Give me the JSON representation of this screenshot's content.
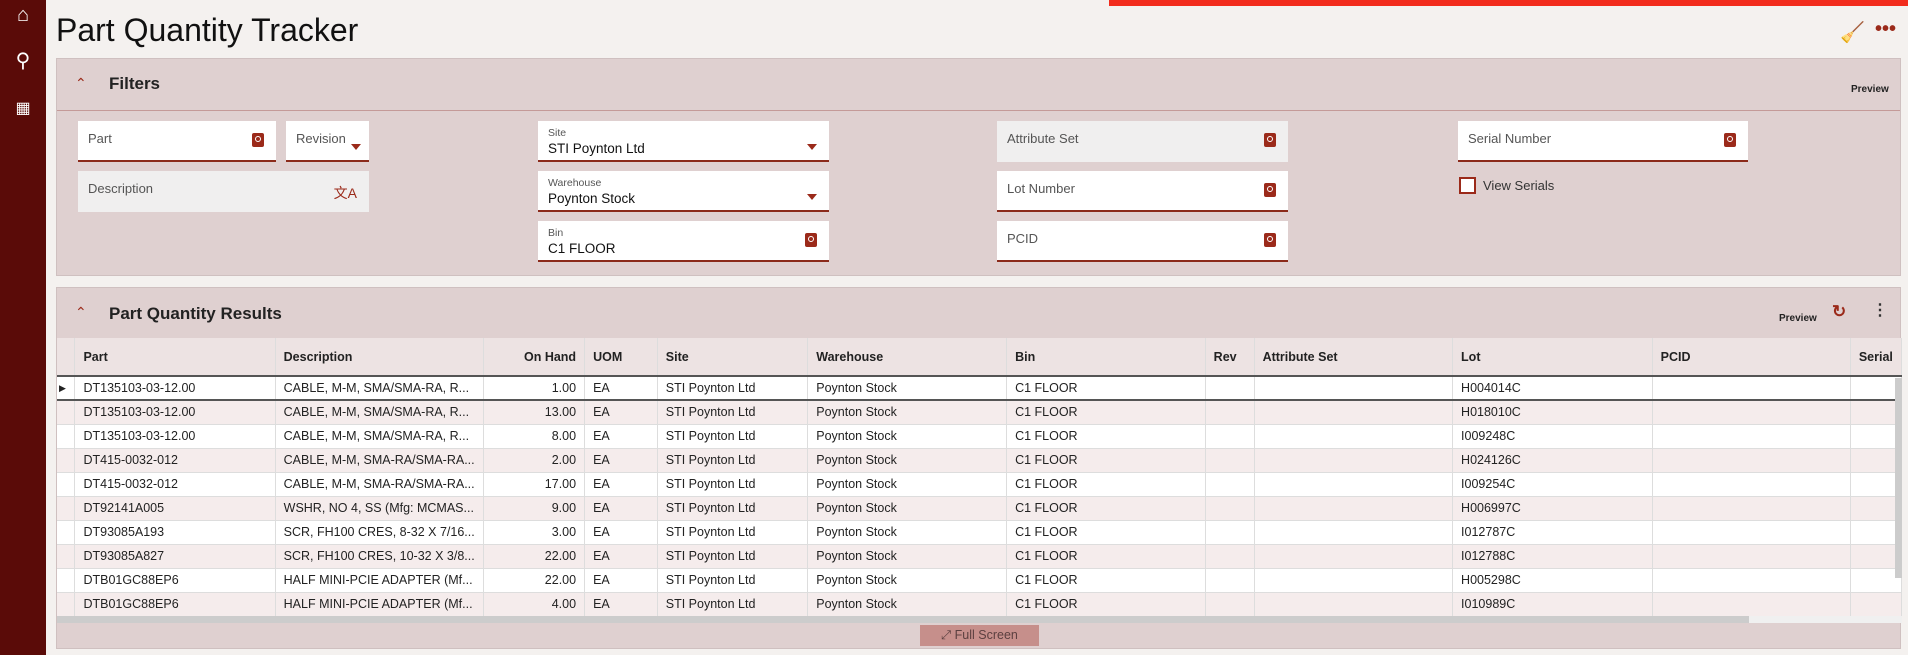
{
  "sidebar": {
    "items": [
      {
        "icon": "home-icon"
      },
      {
        "icon": "search-icon"
      },
      {
        "icon": "apps-grid-icon"
      }
    ]
  },
  "header": {
    "title": "Part Quantity Tracker"
  },
  "filters": {
    "title": "Filters",
    "preview": "Preview",
    "part": {
      "label": "Part",
      "value": ""
    },
    "revision": {
      "label": "Revision"
    },
    "description": {
      "label": "Description"
    },
    "site": {
      "label": "Site",
      "value": "STI Poynton Ltd"
    },
    "warehouse": {
      "label": "Warehouse",
      "value": "Poynton Stock"
    },
    "bin": {
      "label": "Bin",
      "value": "C1 FLOOR"
    },
    "attribute_set": {
      "label": "Attribute Set"
    },
    "lot_number": {
      "label": "Lot Number"
    },
    "pcid": {
      "label": "PCID"
    },
    "serial_number": {
      "label": "Serial Number"
    },
    "view_serials": {
      "label": "View Serials",
      "checked": false
    }
  },
  "results": {
    "title": "Part Quantity Results",
    "preview": "Preview",
    "full_screen": "Full Screen",
    "columns": [
      "Part",
      "Description",
      "On Hand",
      "UOM",
      "Site",
      "Warehouse",
      "Bin",
      "Rev",
      "Attribute Set",
      "Lot",
      "PCID",
      "Serial"
    ],
    "rows": [
      [
        "DT135103-03-12.00",
        "CABLE, M-M, SMA/SMA-RA, R...",
        "1.00",
        "EA",
        "STI Poynton Ltd",
        "Poynton Stock",
        "C1 FLOOR",
        "",
        "",
        "H004014C",
        "",
        ""
      ],
      [
        "DT135103-03-12.00",
        "CABLE, M-M, SMA/SMA-RA, R...",
        "13.00",
        "EA",
        "STI Poynton Ltd",
        "Poynton Stock",
        "C1 FLOOR",
        "",
        "",
        "H018010C",
        "",
        ""
      ],
      [
        "DT135103-03-12.00",
        "CABLE, M-M, SMA/SMA-RA, R...",
        "8.00",
        "EA",
        "STI Poynton Ltd",
        "Poynton Stock",
        "C1 FLOOR",
        "",
        "",
        "I009248C",
        "",
        ""
      ],
      [
        "DT415-0032-012",
        "CABLE, M-M, SMA-RA/SMA-RA...",
        "2.00",
        "EA",
        "STI Poynton Ltd",
        "Poynton Stock",
        "C1 FLOOR",
        "",
        "",
        "H024126C",
        "",
        ""
      ],
      [
        "DT415-0032-012",
        "CABLE, M-M, SMA-RA/SMA-RA...",
        "17.00",
        "EA",
        "STI Poynton Ltd",
        "Poynton Stock",
        "C1 FLOOR",
        "",
        "",
        "I009254C",
        "",
        ""
      ],
      [
        "DT92141A005",
        "WSHR, NO 4, SS (Mfg: MCMAS...",
        "9.00",
        "EA",
        "STI Poynton Ltd",
        "Poynton Stock",
        "C1 FLOOR",
        "",
        "",
        "H006997C",
        "",
        ""
      ],
      [
        "DT93085A193",
        "SCR, FH100 CRES, 8-32 X 7/16...",
        "3.00",
        "EA",
        "STI Poynton Ltd",
        "Poynton Stock",
        "C1 FLOOR",
        "",
        "",
        "I012787C",
        "",
        ""
      ],
      [
        "DT93085A827",
        "SCR, FH100 CRES, 10-32 X 3/8...",
        "22.00",
        "EA",
        "STI Poynton Ltd",
        "Poynton Stock",
        "C1 FLOOR",
        "",
        "",
        "I012788C",
        "",
        ""
      ],
      [
        "DTB01GC88EP6",
        "HALF MINI-PCIE ADAPTER (Mf...",
        "22.00",
        "EA",
        "STI Poynton Ltd",
        "Poynton Stock",
        "C1 FLOOR",
        "",
        "",
        "H005298C",
        "",
        ""
      ],
      [
        "DTB01GC88EP6",
        "HALF MINI-PCIE ADAPTER (Mf...",
        "4.00",
        "EA",
        "STI Poynton Ltd",
        "Poynton Stock",
        "C1 FLOOR",
        "",
        "",
        "I010989C",
        "",
        ""
      ]
    ]
  },
  "colors": {
    "sidebar": "#5a0b08",
    "accent": "#9b2a1a",
    "panel": "#dfd0d0",
    "alert_bar": "#f22c1d"
  }
}
